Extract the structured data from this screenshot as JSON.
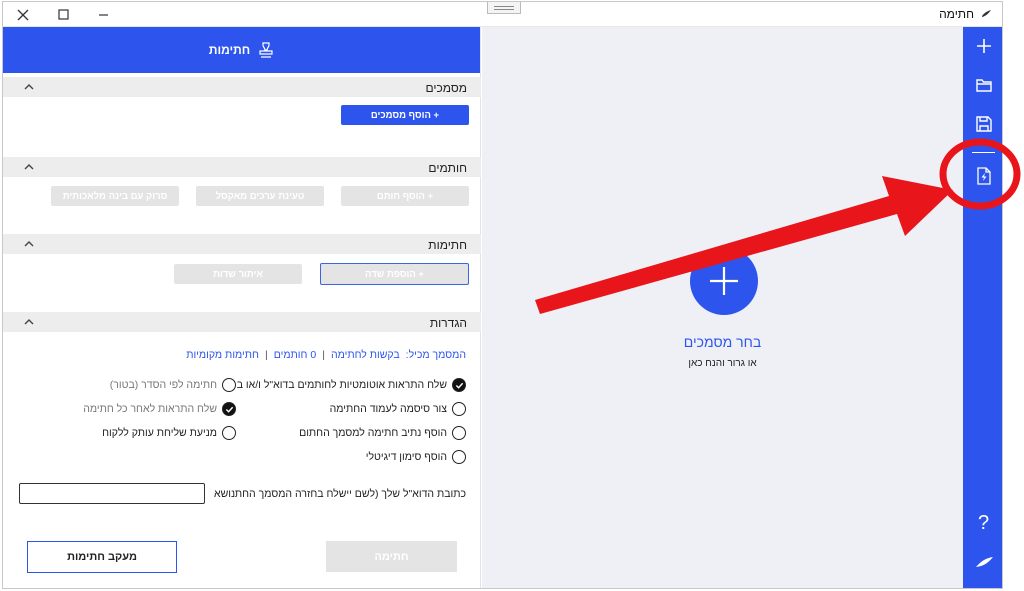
{
  "window": {
    "title": "חתימה"
  },
  "panel": {
    "header_title": "חתימות",
    "sections": {
      "documents": {
        "label": "מסמכים",
        "add_button": "הוסף מסמכים +"
      },
      "signers": {
        "label": "חותמים",
        "add_signer": "הוסף חותם +",
        "load_excel": "טעינת ערכים מאקסל",
        "scan_contacts": "סרוק עם בינה מלאכותית"
      },
      "signatures": {
        "label": "חתימות",
        "add_field": "הוספת שדה +",
        "locate_fields": "איתור שדות"
      },
      "settings": {
        "label": "הגדרות"
      }
    },
    "summary": {
      "prefix": "המסמך מכיל:",
      "requests": "בקשות לחתימה",
      "signers_count": "0 חותמים",
      "local": "חתימות מקומיות",
      "sep": "|"
    },
    "options_right": [
      {
        "label": "שלח התראות אוטומטיות לחותמים בדוא\"ל ו/או ב",
        "checked": true
      },
      {
        "label": "צור סיסמה לעמוד החתימה",
        "checked": false
      },
      {
        "label": "הוסף נתיב חתימה למסמך החתום",
        "checked": false
      },
      {
        "label": "הוסף סימון דיגיטלי",
        "checked": false
      }
    ],
    "options_left": [
      {
        "label": "חתימה לפי הסדר (בטור)",
        "checked": false,
        "muted": true
      },
      {
        "label": "שלח התראות לאחר כל חתימה",
        "checked": true,
        "muted": true
      },
      {
        "label": "מניעת שליחת עותק ללקוח",
        "checked": false,
        "muted": false
      }
    ],
    "email_label": "כתובת הדוא\"ל שלך (לשם יישלח בחזרה המסמך החת",
    "subject_label": "נושא",
    "email_value": "",
    "sign_button": "חתימה",
    "track_button": "מעקב חתימות"
  },
  "droparea": {
    "title": "בחר מסמכים",
    "subtitle": "או גרור והנח כאן"
  },
  "toolbar": {
    "items": [
      "plus-icon",
      "folder-icon",
      "save-icon",
      "file-lightning-icon",
      "help-icon",
      "feather-icon"
    ],
    "help_glyph": "?"
  },
  "colors": {
    "accent": "#2d55ee",
    "annotation": "#e8151b",
    "drop_bg": "#eef0f6"
  }
}
